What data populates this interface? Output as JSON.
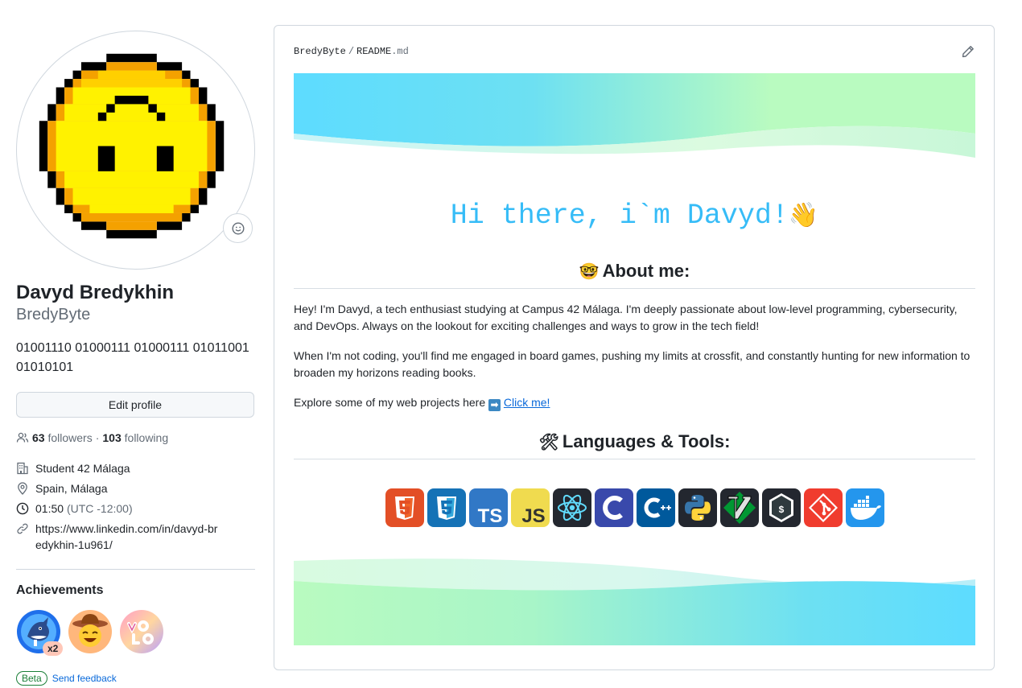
{
  "profile": {
    "fullname": "Davyd Bredykhin",
    "username": "BredyByte",
    "bio": "01001110 01000111 01000111 01011001 01010101",
    "edit_label": "Edit profile",
    "followers_count": "63",
    "followers_label": "followers",
    "dot": "·",
    "following_count": "103",
    "following_label": "following",
    "details": {
      "org": "Student 42 Málaga",
      "location": "Spain, Málaga",
      "time": "01:50",
      "timezone": "(UTC -12:00)",
      "link": "https://www.linkedin.com/in/davyd-bredykhin-1u961/"
    },
    "achievements_title": "Achievements",
    "achievements_x2": "x2",
    "beta": "Beta",
    "feedback": "Send feedback"
  },
  "readme": {
    "owner": "BredyByte",
    "separator": "/",
    "file_name": "README",
    "file_ext": ".md",
    "greeting": "Hi there, i`m Davyd!",
    "greeting_emoji": "👋",
    "about_emoji": "🤓",
    "about_title": "About me:",
    "p1": "Hey! I'm Davyd, a tech enthusiast studying at Campus 42 Málaga. I'm deeply passionate about low-level programming, cybersecurity, and DevOps. Always on the lookout for exciting challenges and ways to grow in the tech field!",
    "p2": "When I'm not coding, you'll find me engaged in board games, pushing my limits at crossfit, and constantly hunting for new information to broaden my horizons reading books.",
    "p3_prefix": "Explore some of my web projects here",
    "p3_arrow": "➡",
    "p3_link": "Click me!",
    "tools_emoji": "🛠",
    "tools_title": "Languages & Tools:",
    "tech_labels": {
      "ts": "TS",
      "js": "JS"
    }
  },
  "colors": {
    "accent": "#36bcf7",
    "link": "#0969da",
    "wave_start": "#5ddcff",
    "wave_end": "#b9fbc0"
  },
  "icons": [
    "smiley-icon",
    "people-icon",
    "organization-icon",
    "location-icon",
    "clock-icon",
    "link-icon",
    "pencil-icon"
  ]
}
